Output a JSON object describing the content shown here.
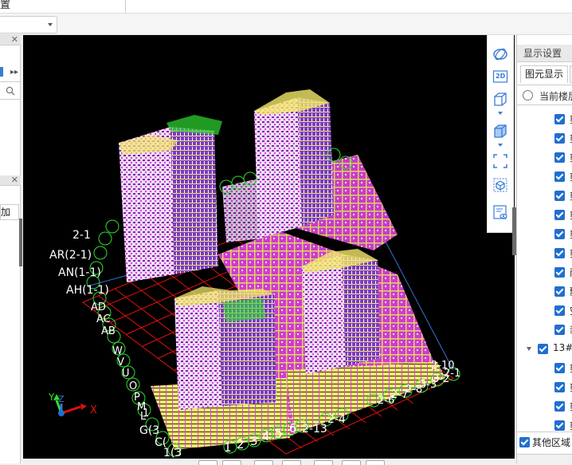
{
  "topbar": {
    "title": "置"
  },
  "left_panel": {
    "search_icon": "search-icon",
    "add_label": "加"
  },
  "viewport": {
    "axis_labels": {
      "x": "X",
      "y": "Y",
      "z": "Z"
    },
    "grid_labels_left": [
      "2-1",
      "AR(2-1)",
      "AN(1-1)",
      "AH(1-1)",
      "AD",
      "AC",
      "AB",
      "W",
      "V",
      "U",
      "O",
      "P",
      "M",
      "L",
      "1",
      "G(3",
      "C(",
      "1(3"
    ],
    "grid_labels_bottom": [
      "1",
      "2",
      "3",
      "4",
      "5",
      "6",
      "2-13",
      "2-4"
    ],
    "grid_labels_right": [
      "2-6",
      "2-7",
      "2-8",
      "3-3",
      "3-2",
      "2-1",
      "2-10"
    ]
  },
  "view_toolbar": {
    "icons": [
      "orbit-icon",
      "2d-view-icon",
      "wireframe-cube-icon",
      "solid-cube-icon",
      "fit-view-icon",
      "iso-view-icon",
      "display-settings-icon"
    ],
    "two_d": "2D",
    "accent": "#3a7bd5"
  },
  "right_panel": {
    "title": "显示设置",
    "tab_active": "图元显示",
    "radio_label": "当前楼层",
    "items": [
      "剪",
      "剪",
      "剪",
      "剪",
      "剪",
      "剪",
      "剪",
      "剪",
      "雨",
      "飘",
      "空",
      "装"
    ],
    "group_label": "13#",
    "group_items": [
      "剪",
      "剪",
      "剪",
      "剪"
    ],
    "footer_label": "其他区域"
  },
  "colors": {
    "viewport_bg": "#000000",
    "building_purple": "#6b2fb0",
    "building_magenta": "#e040e0",
    "slab_yellow": "#f2e86a",
    "grid_red": "#e01010",
    "grid_green": "#2fdc2f",
    "checkbox_blue": "#1f6fd1"
  }
}
